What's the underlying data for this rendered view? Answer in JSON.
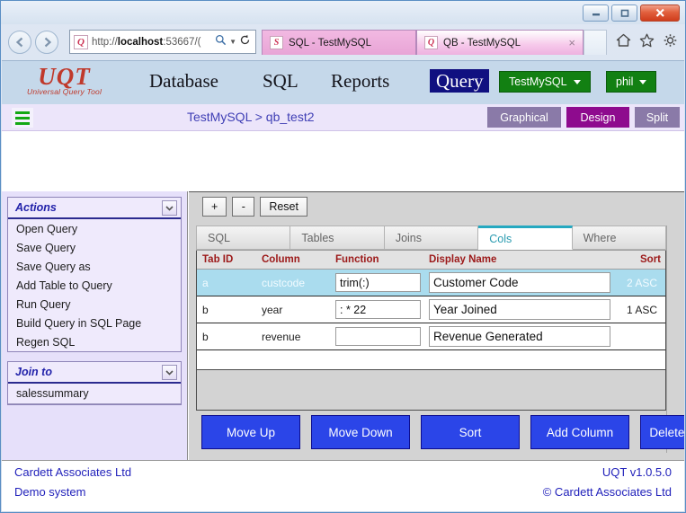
{
  "browser": {
    "window_controls": {
      "minimize": "minimize-icon",
      "maximize": "maximize-icon",
      "close": "close-icon"
    },
    "back_icon": "back-arrow-icon",
    "forward_icon": "forward-arrow-icon",
    "address": {
      "site_icon_letter": "Q",
      "url_prefix": "http://",
      "url_host": "localhost",
      "url_suffix": ":53667/(",
      "search_icon": "search-icon",
      "dropdown_icon": "chevron-down-icon",
      "refresh_icon": "refresh-icon"
    },
    "tabs": [
      {
        "icon_letter": "S",
        "label": "SQL - TestMySQL",
        "active": false
      },
      {
        "icon_letter": "Q",
        "label": "QB - TestMySQL",
        "active": true,
        "close_label": "×"
      }
    ],
    "tools": {
      "home": "home-icon",
      "favorites": "star-icon",
      "settings": "gear-icon"
    }
  },
  "app_header": {
    "logo_main": "UQT",
    "logo_sub": "Universal Query Tool",
    "nav": [
      {
        "label": "Database",
        "active": false
      },
      {
        "label": "SQL",
        "active": false
      },
      {
        "label": "Reports",
        "active": false
      },
      {
        "label": "Query",
        "active": true
      }
    ],
    "connection_button": "TestMySQL",
    "user_button": "phil"
  },
  "crumb_bar": {
    "menu_icon": "hamburger-menu-icon",
    "breadcrumb": "TestMySQL > qb_test2",
    "views": [
      {
        "label": "Graphical",
        "active": false
      },
      {
        "label": "Design",
        "active": true
      },
      {
        "label": "Split",
        "active": false
      }
    ]
  },
  "sidebar": {
    "panels": [
      {
        "title": "Actions",
        "collapse_icon": "chevron-down-icon",
        "items": [
          "Open Query",
          "Save Query",
          "Save Query as",
          "Add Table to Query",
          "Run Query",
          "Build Query in SQL Page",
          "Regen SQL"
        ]
      },
      {
        "title": "Join to",
        "collapse_icon": "chevron-down-icon",
        "items": [
          "salessummary"
        ]
      }
    ]
  },
  "main": {
    "toolbar": [
      {
        "label": "+"
      },
      {
        "label": "-"
      },
      {
        "label": "Reset"
      }
    ],
    "tabs": [
      {
        "label": "SQL",
        "active": false
      },
      {
        "label": "Tables",
        "active": false
      },
      {
        "label": "Joins",
        "active": false
      },
      {
        "label": "Cols",
        "active": true
      },
      {
        "label": "Where",
        "active": false
      }
    ],
    "grid": {
      "headers": [
        "Tab ID",
        "Column",
        "Function",
        "Display Name",
        "Sort"
      ],
      "rows": [
        {
          "tab_id": "a",
          "column": "custcode",
          "function": "trim(:)",
          "display_name": "Customer Code",
          "sort": "2 ASC",
          "selected": true
        },
        {
          "tab_id": "b",
          "column": "year",
          "function": ": * 22",
          "display_name": "Year Joined",
          "sort": "1 ASC",
          "selected": false
        },
        {
          "tab_id": "b",
          "column": "revenue",
          "function": "",
          "display_name": "Revenue Generated",
          "sort": "",
          "selected": false
        }
      ]
    },
    "actions": [
      "Move Up",
      "Move Down",
      "Sort",
      "Add Column",
      "Delete Column"
    ]
  },
  "footer": {
    "left_line1": "Cardett Associates Ltd",
    "left_line2": "Demo system",
    "right_line1": "UQT v1.0.5.0",
    "right_line2": "© Cardett Associates Ltd"
  },
  "colors": {
    "accent_green": "#128012",
    "accent_navy": "#101080",
    "active_view": "#8e0b8e",
    "action_blue": "#2b45e8",
    "header_red": "#9c1919",
    "logo_red": "#c0392b",
    "selected_row": "#aadcee",
    "active_tab_border": "#25a8c0"
  }
}
